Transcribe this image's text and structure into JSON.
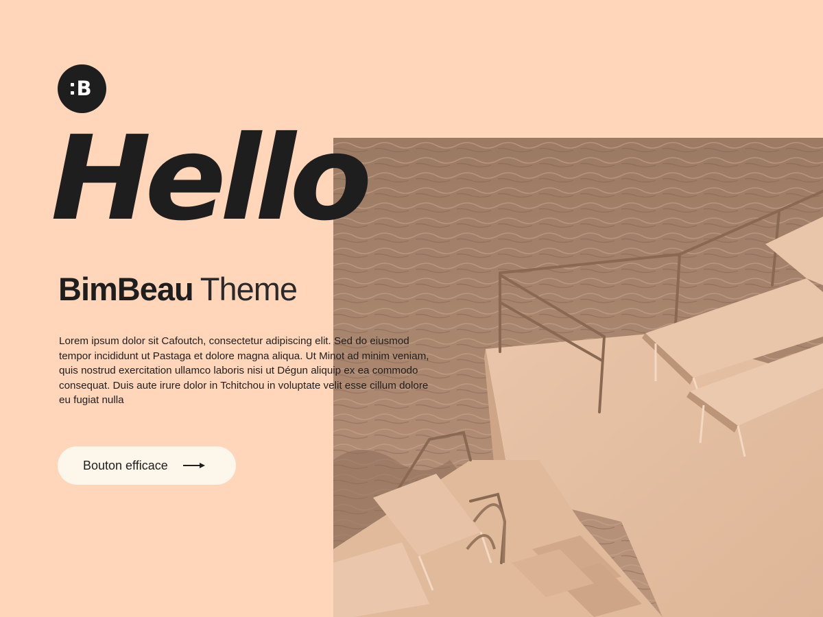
{
  "brand": {
    "logo_letter": "B",
    "name_bold": "BimBeau",
    "name_light": "Theme"
  },
  "hero": {
    "headline": "Hello",
    "body": "Lorem ipsum dolor sit Cafoutch, consectetur adipiscing elit. Sed do eiusmod tempor incididunt ut Pastaga et dolore magna aliqua. Ut Minot ad minim veniam, quis nostrud exercitation ullamco laboris nisi ut Dégun aliquip ex ea commodo consequat. Duis aute irure dolor in Tchitchou in voluptate velit esse cillum dolore eu fugiat nulla"
  },
  "cta": {
    "label": "Bouton efficace",
    "icon": "arrow-right-icon"
  },
  "colors": {
    "background": "#FFD6BA",
    "text": "#1E1E1E",
    "button_bg": "#FDF6EA",
    "logo_bg": "#1E1E1E"
  },
  "image": {
    "icon": "seaside-pool-photo"
  }
}
